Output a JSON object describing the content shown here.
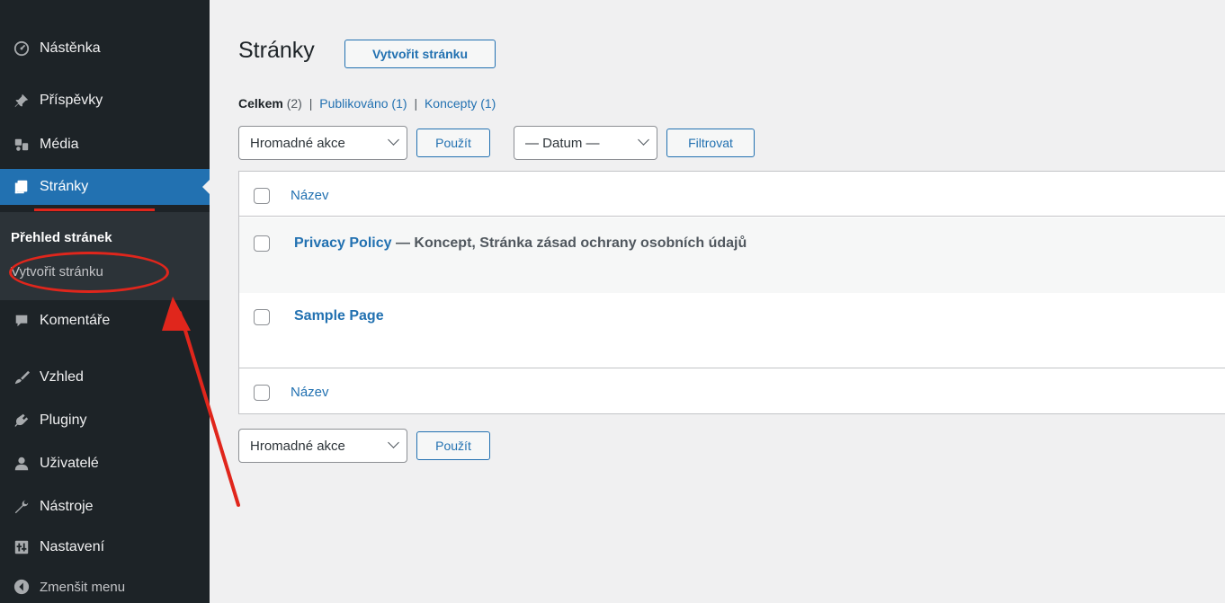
{
  "sidebar": {
    "items": [
      {
        "label": "Nástěnka",
        "icon": "dashboard-icon"
      },
      {
        "label": "Příspěvky",
        "icon": "pin-icon"
      },
      {
        "label": "Média",
        "icon": "media-icon"
      },
      {
        "label": "Stránky",
        "icon": "page-icon"
      },
      {
        "label": "Komentáře",
        "icon": "comment-icon"
      },
      {
        "label": "Vzhled",
        "icon": "brush-icon"
      },
      {
        "label": "Pluginy",
        "icon": "plug-icon"
      },
      {
        "label": "Uživatelé",
        "icon": "user-icon"
      },
      {
        "label": "Nástroje",
        "icon": "wrench-icon"
      },
      {
        "label": "Nastavení",
        "icon": "settings-icon"
      },
      {
        "label": "Zmenšit menu",
        "icon": "collapse-icon"
      }
    ],
    "submenu": {
      "current": "Přehled stránek",
      "add_new": "Vytvořit stránku"
    }
  },
  "main": {
    "title": "Stránky",
    "add_new_button": "Vytvořit stránku",
    "views": {
      "all": "Celkem",
      "all_count": "(2)",
      "separator": "|",
      "published": "Publikováno",
      "published_count": "(1)",
      "drafts": "Koncepty",
      "drafts_count": "(1)"
    },
    "bulk_actions": "Hromadné akce",
    "apply": "Použít",
    "date_filter": "— Datum —",
    "filter": "Filtrovat",
    "column_title": "Název",
    "rows": [
      {
        "title": "Privacy Policy",
        "state": " — Koncept, Stránka zásad ochrany osobních údajů"
      },
      {
        "title": "Sample Page",
        "state": ""
      }
    ]
  },
  "colors": {
    "sidebar_bg": "#1d2327",
    "accent": "#2271b1",
    "annotation_red": "#e0261c"
  }
}
